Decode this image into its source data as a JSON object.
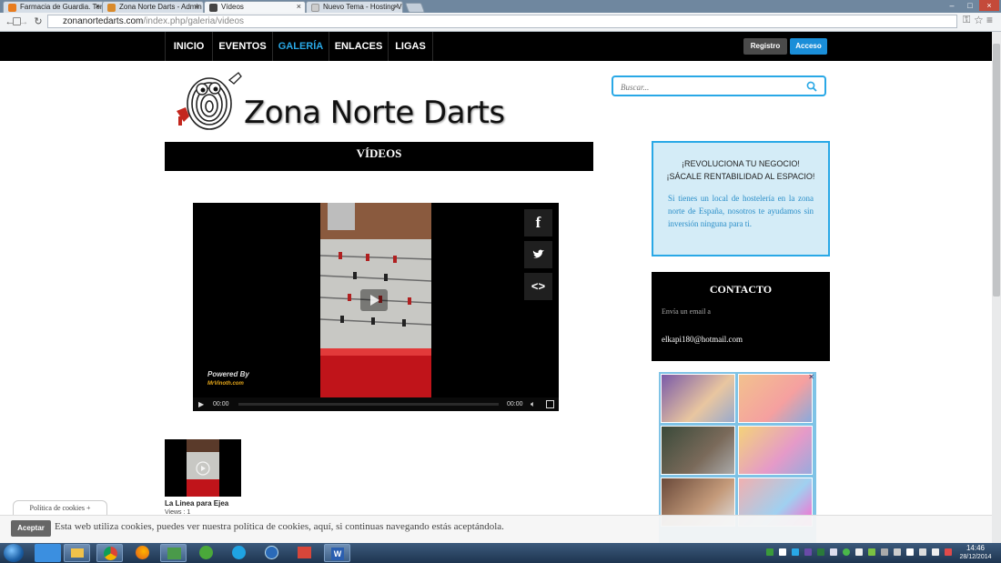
{
  "browser": {
    "tabs": [
      {
        "label": "Farmacia de Guardia. Terr",
        "icon_color": "#e87c1e",
        "active": false
      },
      {
        "label": "Zona Norte Darts - Admin",
        "icon_color": "#d98a2b",
        "active": false
      },
      {
        "label": "Vídeos",
        "icon_color": "#444444",
        "active": true
      },
      {
        "label": "Nuevo Tema - Hosting Vi",
        "icon_color": "#cccccc",
        "active": false
      }
    ],
    "tab_close": "×",
    "url_host": "zonanortedarts.com",
    "url_path": "/index.php/galeria/videos",
    "window_controls": [
      "–",
      "□",
      "×"
    ]
  },
  "nav": {
    "items": [
      "INICIO",
      "EVENTOS",
      "GALERÍA",
      "ENLACES",
      "LIGAS"
    ],
    "active": "GALERÍA",
    "active_color": "#29a8e6",
    "register": "Registro",
    "login": "Acceso"
  },
  "logo": {
    "text": "Zona Norte Darts"
  },
  "search": {
    "placeholder": "Buscar..."
  },
  "main": {
    "heading": "VÍDEOS",
    "player": {
      "time_current": "00:00",
      "time_total": "00:00",
      "powered_by": "Powered By",
      "brand": "MrVinoth.com",
      "share_icons": [
        "facebook-icon",
        "twitter-icon",
        "embed-icon"
      ]
    },
    "thumbnail": {
      "title": "La Linea para Ejea",
      "views": "Views : 1"
    }
  },
  "promo": {
    "line1": "¡REVOLUCIONA TU NEGOCIO!",
    "line2": "¡SÁCALE RENTABILIDAD AL ESPACIO!",
    "body": "Si tienes un local de hostelería en la zona norte de España, nosotros te ayudamos sin inversión ninguna para ti."
  },
  "contact": {
    "title": "CONTACTO",
    "hint": "Envía un email a",
    "email": "elkapi180@hotmail.com"
  },
  "cookies": {
    "tab": "Política de cookies +",
    "accept": "Aceptar",
    "text": "Esta web utiliza cookies, puedes ver nuestra política de cookies, aquí, si continuas navegando estás aceptándola."
  },
  "taskbar": {
    "time": "14:46",
    "date": "28/12/2014"
  },
  "colors": {
    "accent": "#29a8e6",
    "promo_bg": "#d4ecf7",
    "login_btn": "#1a8ed8"
  }
}
